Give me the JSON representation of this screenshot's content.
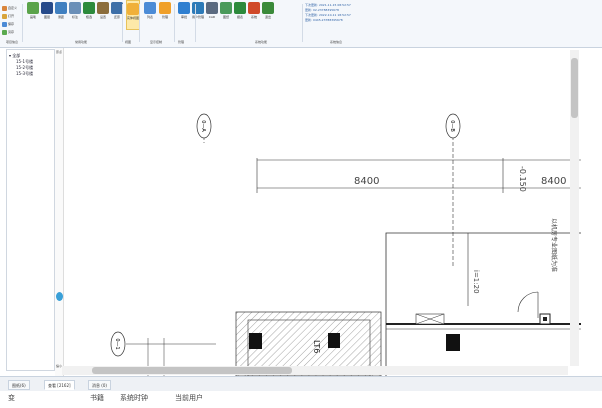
{
  "ribbon": {
    "small_stack": [
      {
        "label": "自定义",
        "color": "#d9843b"
      },
      {
        "label": "打开",
        "color": "#d8a43b"
      },
      {
        "label": "保存",
        "color": "#4b8bd6"
      },
      {
        "label": "另存",
        "color": "#5aaa4f"
      }
    ],
    "buttons": [
      {
        "label": "画笔",
        "color": "#5aa34a",
        "active": false
      },
      {
        "label": "图层",
        "color": "#264a8a",
        "active": false
      },
      {
        "label": "测距",
        "color": "#3f7fc0",
        "active": false
      },
      {
        "label": "标注",
        "color": "#6a8fb8",
        "active": false
      },
      {
        "label": "框选",
        "color": "#2c8a3c",
        "active": false
      },
      {
        "label": "设置",
        "color": "#8b6d3c",
        "active": false
      },
      {
        "label": "还原",
        "color": "#3d6fa8",
        "active": false
      },
      {
        "label": "实体视图",
        "color": "#f0b03a",
        "active": true
      },
      {
        "label": "列表",
        "color": "#4b8bd6",
        "active": false
      },
      {
        "label": "管理",
        "color": "#f0a02a",
        "active": false
      },
      {
        "label": "审批",
        "color": "#2f7fd0",
        "active": false
      },
      {
        "label": "用户管理",
        "color": "#2c7ab8",
        "active": false
      },
      {
        "label": "CAD",
        "color": "#5a6a80",
        "active": false
      },
      {
        "label": "图纸",
        "color": "#4a9a5a",
        "active": false
      },
      {
        "label": "报表",
        "color": "#2c8a3c",
        "active": false
      },
      {
        "label": "系统",
        "color": "#d04a2a",
        "active": false
      },
      {
        "label": "退出",
        "color": "#3a8a3a",
        "active": false
      }
    ],
    "group_labels": [
      "项目信息",
      "常用功能",
      "视图",
      "显示控制",
      "管理",
      "系统功能",
      "系统信息"
    ],
    "info_lines": [
      "下次更新: 2021-11-15 08:52:57",
      "更新: 02-23788395678",
      "下次更新: 2022-10-11 18:52:57",
      "更新: 0445-23788395678"
    ]
  },
  "sidebar": {
    "root": "▾ 全部",
    "items": [
      "15-1号楼",
      "15-2号楼",
      "15-3号楼"
    ]
  },
  "drawing": {
    "axes": [
      "0—A",
      "0—B",
      "0—1"
    ],
    "dims": [
      "8400",
      "8400",
      "-0.150"
    ],
    "slope": "i=1:20",
    "beam": "LT6",
    "note": "以机房专业图纸为准",
    "ruler_top": "原点",
    "ruler_bottom": "缩小"
  },
  "tabs": [
    "图纸(6)",
    "查看 [2162]",
    "消息 (0)"
  ],
  "status": [
    "变",
    "书籍",
    "系统时钟",
    "当前用户"
  ],
  "colors": {
    "accent": "#2f62a6",
    "marker": "#3aa0d8"
  }
}
